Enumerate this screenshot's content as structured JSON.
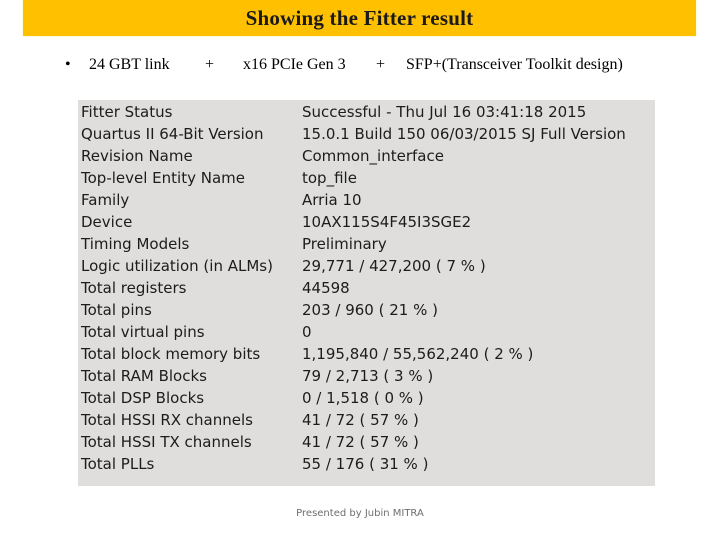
{
  "slide": {
    "title": "Showing the Fitter result",
    "subtitle": {
      "bullet": "•",
      "part1": "24 GBT link",
      "plus1": "+",
      "part2": "x16 PCIe Gen 3",
      "plus2": "+",
      "part3": "SFP+(Transceiver Toolkit design)"
    },
    "footer": "Presented by Jubin MITRA"
  },
  "fitter_report": {
    "rows": [
      {
        "label": "Fitter Status",
        "value": "Successful - Thu Jul 16 03:41:18 2015"
      },
      {
        "label": "Quartus II 64-Bit Version",
        "value": "15.0.1 Build 150 06/03/2015 SJ Full Version"
      },
      {
        "label": "Revision Name",
        "value": "Common_interface"
      },
      {
        "label": "Top-level Entity Name",
        "value": "top_file"
      },
      {
        "label": "Family",
        "value": "Arria 10"
      },
      {
        "label": "Device",
        "value": "10AX115S4F45I3SGE2"
      },
      {
        "label": "Timing Models",
        "value": "Preliminary"
      },
      {
        "label": "Logic utilization (in ALMs)",
        "value": "29,771 / 427,200 ( 7 % )"
      },
      {
        "label": "Total registers",
        "value": "44598"
      },
      {
        "label": "Total pins",
        "value": "203 / 960 ( 21 % )"
      },
      {
        "label": "Total virtual pins",
        "value": "0"
      },
      {
        "label": "Total block memory bits",
        "value": "1,195,840 / 55,562,240 ( 2 % )"
      },
      {
        "label": "Total RAM Blocks",
        "value": "79 / 2,713 ( 3 % )"
      },
      {
        "label": "Total DSP Blocks",
        "value": "0 / 1,518 ( 0 % )"
      },
      {
        "label": "Total HSSI RX channels",
        "value": "41 / 72 ( 57 % )"
      },
      {
        "label": "Total HSSI TX channels",
        "value": "41 / 72 ( 57 % )"
      },
      {
        "label": "Total PLLs",
        "value": "55 / 176 ( 31 % )"
      }
    ]
  }
}
